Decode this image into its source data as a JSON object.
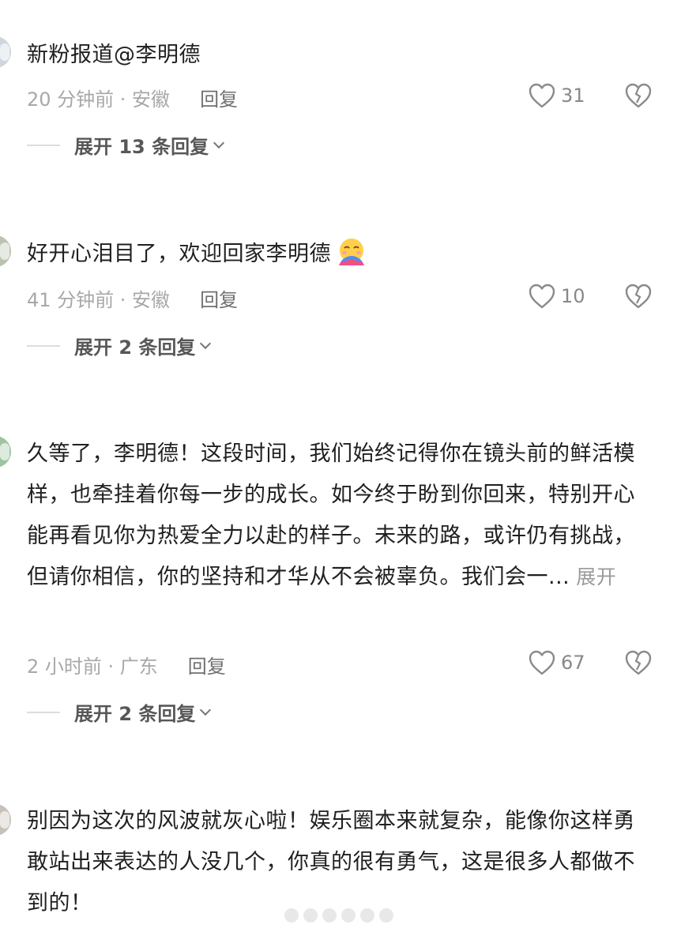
{
  "comments": [
    {
      "text": "新粉报道@李明德",
      "time_location": "20 分钟前 · 安徽",
      "reply_label": "回复",
      "likes": "31",
      "replies_label": "展开 13 条回复"
    },
    {
      "text": "好开心泪目了，欢迎回家李明德",
      "time_location": "41 分钟前 · 安徽",
      "reply_label": "回复",
      "likes": "10",
      "replies_label": "展开 2 条回复"
    },
    {
      "text": "久等了，李明德！这段时间，我们始终记得你在镜头前的鲜活模样，也牵挂着你每一步的成长。如今终于盼到你回来，特别开心能再看见你为热爱全力以赴的样子。未来的路，或许仍有挑战，但请你相信，你的坚持和才华从不会被辜负。我们会一...",
      "expand_label": "展开",
      "time_location": "2 小时前 · 广东",
      "reply_label": "回复",
      "likes": "67",
      "replies_label": "展开 2 条回复"
    },
    {
      "text": "别因为这次的风波就灰心啦！娱乐圈本来就复杂，能像你这样勇敢站出来表达的人没几个，你真的很有勇气，这是很多人都做不到的！"
    }
  ],
  "icons": {
    "like": "heart-outline-icon",
    "dislike": "broken-heart-icon",
    "expand": "chevron-down-icon",
    "emoji": "hugging-face-emoji"
  },
  "colors": {
    "text": "#202020",
    "meta": "#a8a8a8",
    "icon": "#888888"
  }
}
